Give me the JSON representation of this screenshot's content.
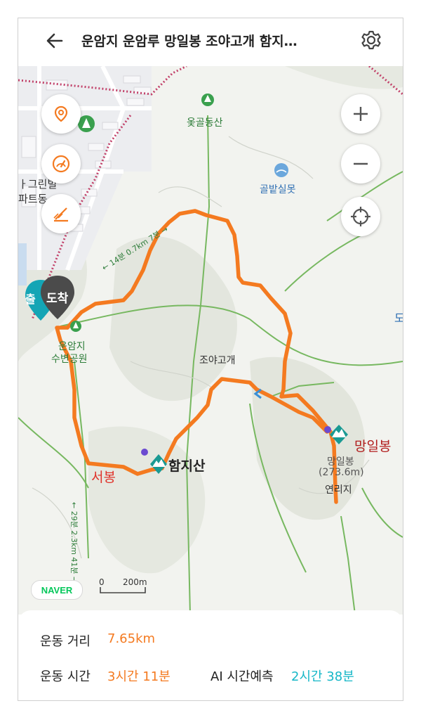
{
  "header": {
    "title": "운암지 운암루 망일봉 조야고개 함지…"
  },
  "icons": {
    "back": "arrow-left-icon",
    "settings": "gear-icon",
    "location_pin": "map-pin-icon",
    "speedometer": "speedometer-icon",
    "elevation": "elevation-icon",
    "zoom_in": "plus-icon",
    "zoom_out": "minus-icon",
    "my_location": "crosshair-icon"
  },
  "map": {
    "labels": {
      "park_oksil": "옻골동산",
      "pond": "골밭실못",
      "apt_line1": "ㅏ그린빌",
      "apt_line2": "파트동",
      "park_unamji_1": "운암지",
      "park_unamji_2": "수변공원",
      "pass": "조야고개",
      "hamjisan": "함지산",
      "seobong": "서봉",
      "mangilbong": "망일봉",
      "mangilbong_small": "망일봉",
      "mangilbong_elev": "(273.6m)",
      "yeonriji": "연리지",
      "trail_14": "← 14분 0.7km 7분 →",
      "trail_29": "← 29분 2.3km 41분 →",
      "edge_do": "도",
      "arrive_pin": "도착",
      "start_pin": "출"
    },
    "scale": {
      "zero": "0",
      "dist": "200m"
    },
    "brand": "NAVER",
    "route_color": "#f47a20",
    "marker_color": "#1a9a93"
  },
  "stats": {
    "distance_label": "운동 거리",
    "distance_value": "7.65km",
    "time_label": "운동 시간",
    "time_value": "3시간 11분",
    "ai_label": "AI 시간예측",
    "ai_value": "2시간 38분"
  },
  "colors": {
    "accent": "#f47a20",
    "teal": "#16b7c7",
    "map_bg": "#f2f3ef"
  }
}
